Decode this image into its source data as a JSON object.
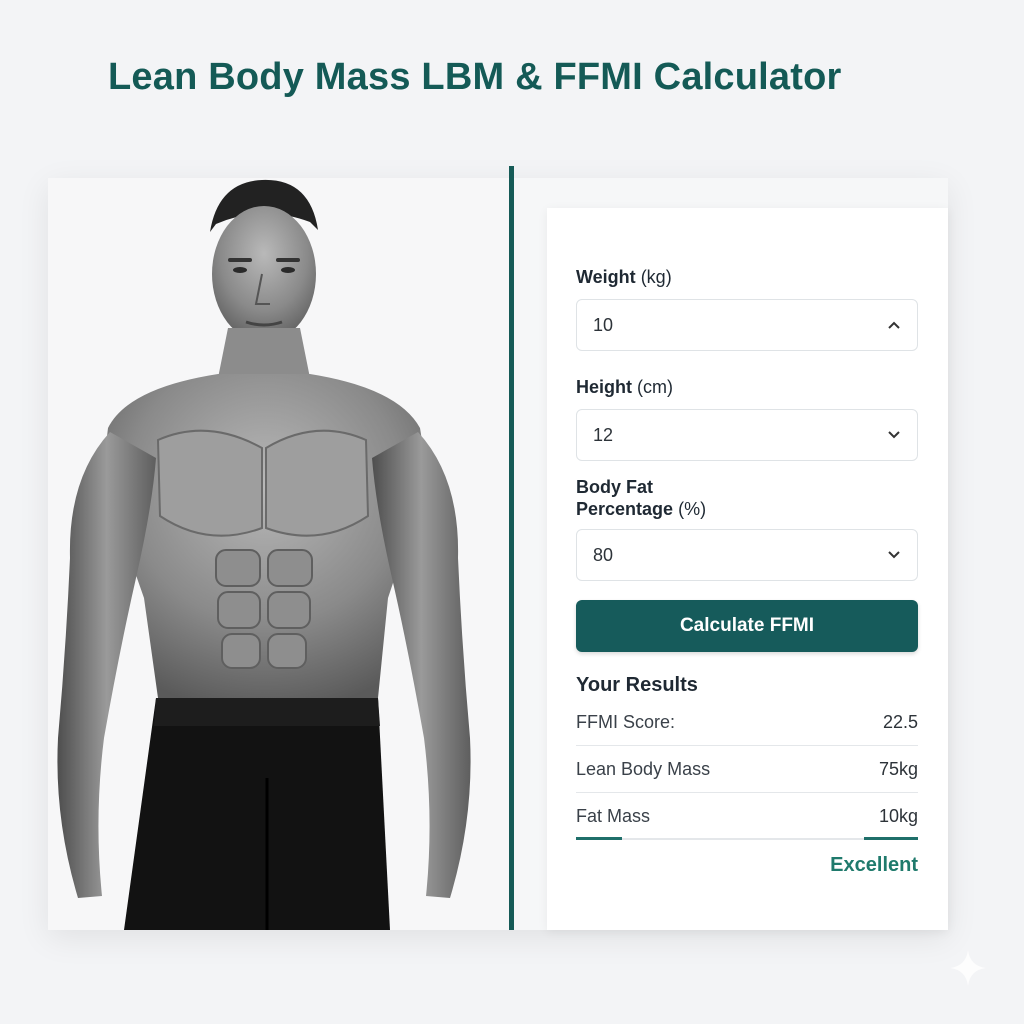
{
  "page": {
    "title": "Lean Body Mass LBM & FFMI Calculator"
  },
  "colors": {
    "accent": "#165b57",
    "button": "#165b5b",
    "rating": "#1f7a6c"
  },
  "form": {
    "weight": {
      "label_strong": "Weight",
      "label_unit": "(kg)",
      "value": "10",
      "icon": "chevron-up-icon"
    },
    "height": {
      "label_strong": "Height",
      "label_unit": "(cm)",
      "value": "12",
      "icon": "chevron-down-icon"
    },
    "body_fat": {
      "label_line1": "Body Fat",
      "label_strong2": "Percentage",
      "label_unit": "(%)",
      "value": "80",
      "icon": "chevron-down-icon"
    },
    "calculate_label": "Calculate FFMI"
  },
  "results": {
    "title": "Your Results",
    "rows": [
      {
        "label": "FFMI Score:",
        "value": "22.5"
      },
      {
        "label": "Lean Body Mass",
        "value": "75kg"
      },
      {
        "label": "Fat Mass",
        "value": "10kg"
      }
    ],
    "rating": "Excellent"
  }
}
